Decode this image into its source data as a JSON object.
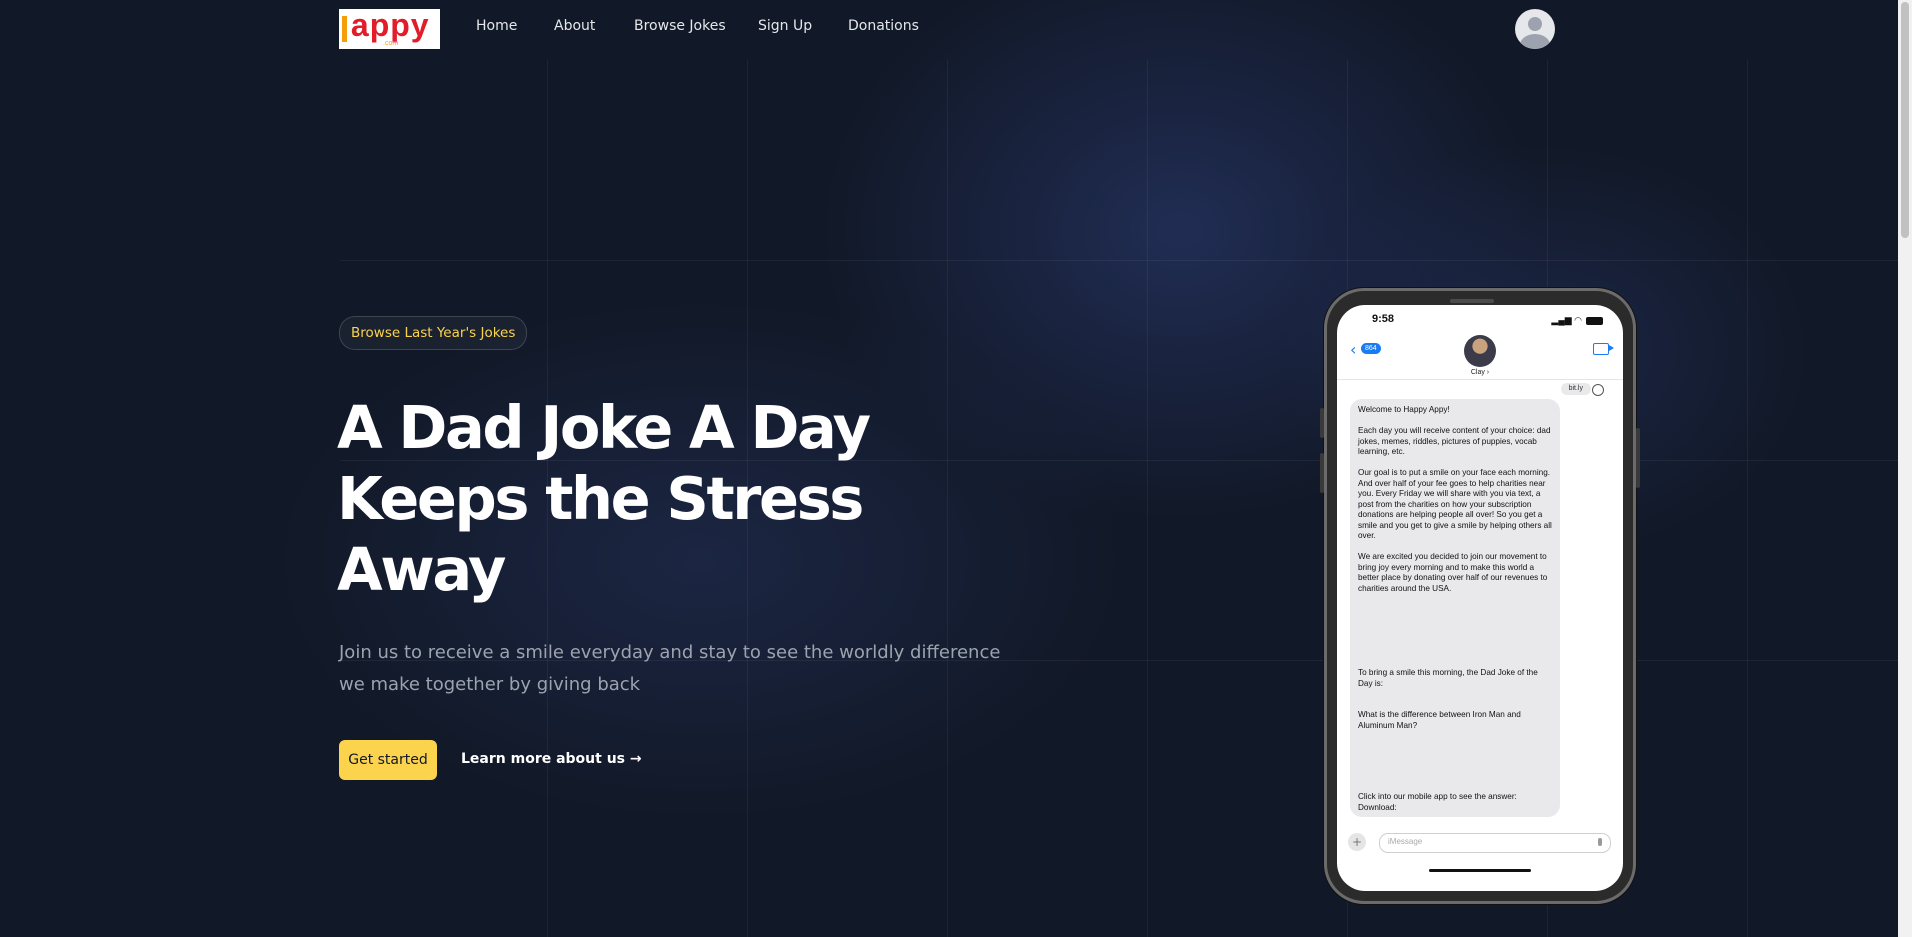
{
  "logo": {
    "text": "appy",
    "sub": ".com"
  },
  "nav": {
    "links": [
      "Home",
      "About",
      "Browse Jokes",
      "Sign Up",
      "Donations"
    ]
  },
  "hero": {
    "badge": "Browse Last Year's Jokes",
    "headline": "A Dad Joke A Day Keeps the Stress Away",
    "subtext": "Join us to receive a smile everyday and stay to see the worldly difference we make together by giving back",
    "cta_label": "Get started",
    "learn_more": "Learn more about us →"
  },
  "phone": {
    "time": "9:58",
    "back_count": "864",
    "contact_name": "Clay",
    "link_chip": "bit.ly",
    "message": {
      "p1": "Welcome to Happy Appy!",
      "p2": "Each day you will receive content of your choice: dad jokes, memes, riddles, pictures of puppies, vocab learning, etc.",
      "p3": "Our goal is to put a smile on your face each morning. And over half of your fee goes to help charities near you. Every Friday we will share with you via text, a post from the charities on how your subscription donations are helping people all over! So you get a smile and you get to give a smile by helping others all over.",
      "p4": "We are excited you decided to join our movement to bring joy every morning and to make this world a better place by donating over half of our revenues to charities around the USA.",
      "p5": "To bring a smile this morning, the Dad Joke of the Day is:",
      "p6": "What is the difference between Iron Man and Aluminum Man?",
      "p7": "Click into our mobile app to see the answer: Download:"
    },
    "compose_placeholder": "iMessage"
  },
  "colors": {
    "background": "#111827",
    "accent": "#fcd34d",
    "imessage_blue": "#1a7cf5"
  }
}
